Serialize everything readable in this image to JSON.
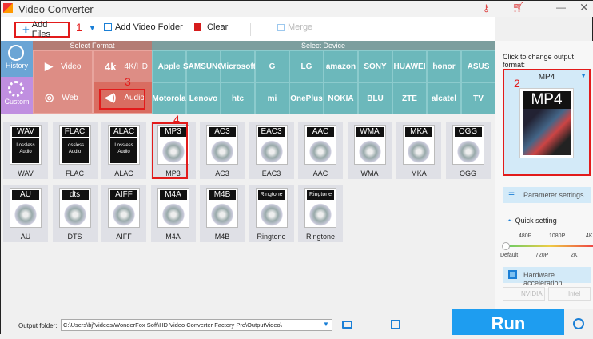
{
  "title": "Video Converter",
  "toolbar": {
    "add_files": "Add Files",
    "add_folder": "Add Video Folder",
    "clear": "Clear",
    "merge": "Merge"
  },
  "annotations": [
    "1",
    "2",
    "3",
    "4"
  ],
  "side": {
    "history": "History",
    "custom": "Custom"
  },
  "select_format": {
    "header": "Select Format",
    "items": [
      "Video",
      "4K/HD",
      "Web",
      "Audio"
    ]
  },
  "select_device": {
    "header": "Select Device",
    "items": [
      "Apple",
      "SAMSUNG",
      "Microsoft",
      "G",
      "LG",
      "amazon",
      "SONY",
      "HUAWEI",
      "honor",
      "ASUS",
      "Motorola",
      "Lenovo",
      "htc",
      "mi",
      "OnePlus",
      "NOKIA",
      "BLU",
      "ZTE",
      "alcatel",
      "TV"
    ]
  },
  "audio_formats": [
    {
      "tag": "WAV",
      "name": "WAV"
    },
    {
      "tag": "FLAC",
      "name": "FLAC"
    },
    {
      "tag": "ALAC",
      "name": "ALAC"
    },
    {
      "tag": "MP3",
      "name": "MP3"
    },
    {
      "tag": "AC3",
      "name": "AC3"
    },
    {
      "tag": "EAC3",
      "name": "EAC3"
    },
    {
      "tag": "AAC",
      "name": "AAC"
    },
    {
      "tag": "WMA",
      "name": "WMA"
    },
    {
      "tag": "MKA",
      "name": "MKA"
    },
    {
      "tag": "OGG",
      "name": "OGG"
    },
    {
      "tag": "AU",
      "name": "AU"
    },
    {
      "tag": "dts",
      "name": "DTS"
    },
    {
      "tag": "AIFF",
      "name": "AIFF"
    },
    {
      "tag": "M4A",
      "name": "M4A"
    },
    {
      "tag": "M4B",
      "name": "M4B"
    },
    {
      "tag": "Ringtone",
      "name": "Ringtone"
    },
    {
      "tag": "Ringtone",
      "name": "Ringtone"
    }
  ],
  "lossless_text": "Lossless Audio",
  "right": {
    "hint": "Click to change output format:",
    "format": "MP4",
    "param": "Parameter settings",
    "quick": "Quick setting",
    "ticks_top": [
      "480P",
      "1080P",
      "4K"
    ],
    "ticks_bottom": [
      "Default",
      "720P",
      "2K"
    ],
    "quick_value": 0,
    "hw": "Hardware acceleration",
    "nvidia": "NVIDIA",
    "intel": "Intel"
  },
  "bottom": {
    "label": "Output folder:",
    "path": "C:\\Users\\bj\\Videos\\WonderFox Soft\\HD Video Converter Factory Pro\\OutputVideo\\",
    "run": "Run"
  }
}
